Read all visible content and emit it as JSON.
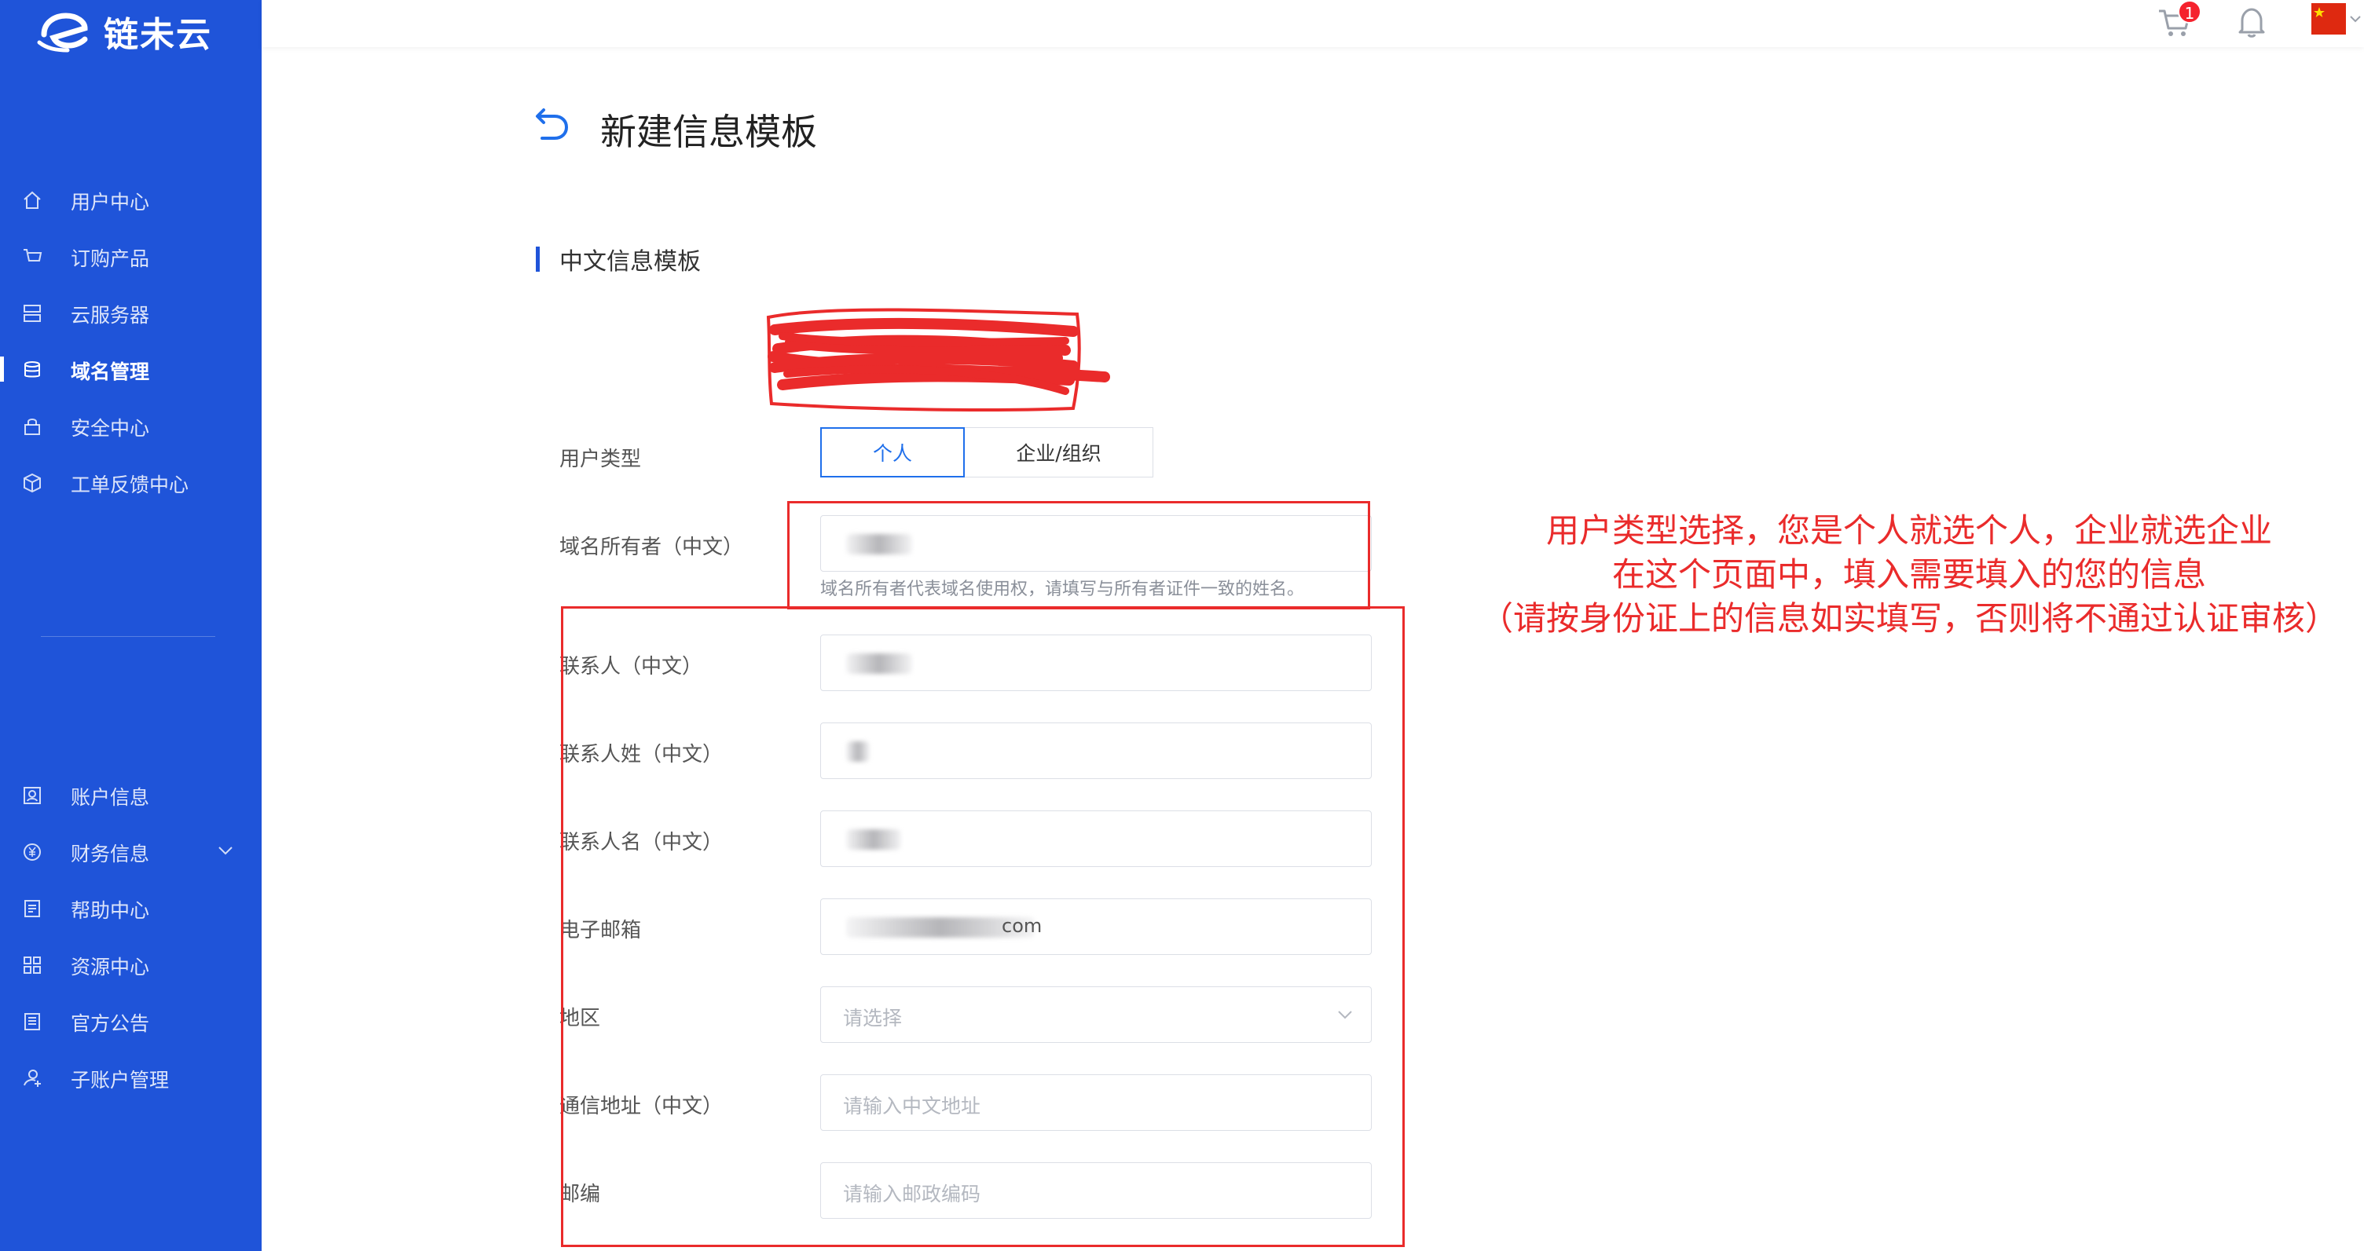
{
  "brand": {
    "name": "链未云"
  },
  "sidebar": {
    "items": [
      {
        "label": "用户中心",
        "icon": "home-icon"
      },
      {
        "label": "订购产品",
        "icon": "cart-icon"
      },
      {
        "label": "云服务器",
        "icon": "server-icon"
      },
      {
        "label": "域名管理",
        "icon": "database-icon",
        "active": true
      },
      {
        "label": "安全中心",
        "icon": "lock-icon"
      },
      {
        "label": "工单反馈中心",
        "icon": "cube-icon"
      },
      {
        "label": "账户信息",
        "icon": "user-card-icon"
      },
      {
        "label": "财务信息",
        "icon": "yuan-icon",
        "expandable": true
      },
      {
        "label": "帮助中心",
        "icon": "document-icon"
      },
      {
        "label": "资源中心",
        "icon": "grid-icon"
      },
      {
        "label": "官方公告",
        "icon": "notice-icon"
      },
      {
        "label": "子账户管理",
        "icon": "sub-account-icon"
      }
    ]
  },
  "topbar": {
    "cart_count": "1",
    "language_flag": "china-flag-icon"
  },
  "page": {
    "title": "新建信息模板",
    "section_title": "中文信息模板"
  },
  "form": {
    "user_type": {
      "label": "用户类型",
      "options": [
        "个人",
        "企业/组织"
      ],
      "selected": "个人"
    },
    "owner": {
      "label": "域名所有者（中文）",
      "hint": "域名所有者代表域名使用权，请填写与所有者证件一致的姓名。"
    },
    "contact": {
      "label": "联系人（中文）"
    },
    "surname": {
      "label": "联系人姓（中文）"
    },
    "given_name": {
      "label": "联系人名（中文）"
    },
    "email": {
      "label": "电子邮箱",
      "value_suffix": "com"
    },
    "region": {
      "label": "地区",
      "placeholder": "请选择"
    },
    "address": {
      "label": "通信地址（中文）",
      "placeholder": "请输入中文地址"
    },
    "postcode": {
      "label": "邮编",
      "placeholder": "请输入邮政编码"
    }
  },
  "annotation": {
    "lines": [
      "用户类型选择，您是个人就选个人，企业就选企业",
      "在这个页面中，填入需要填入的您的信息",
      "（请按身份证上的信息如实填写，否则将不通过认证审核）"
    ],
    "color": "#ea2b2b"
  },
  "colors": {
    "sidebar_bg": "#1f54d9",
    "accent": "#1f6feb",
    "annotation_red": "#ea2b2b"
  }
}
